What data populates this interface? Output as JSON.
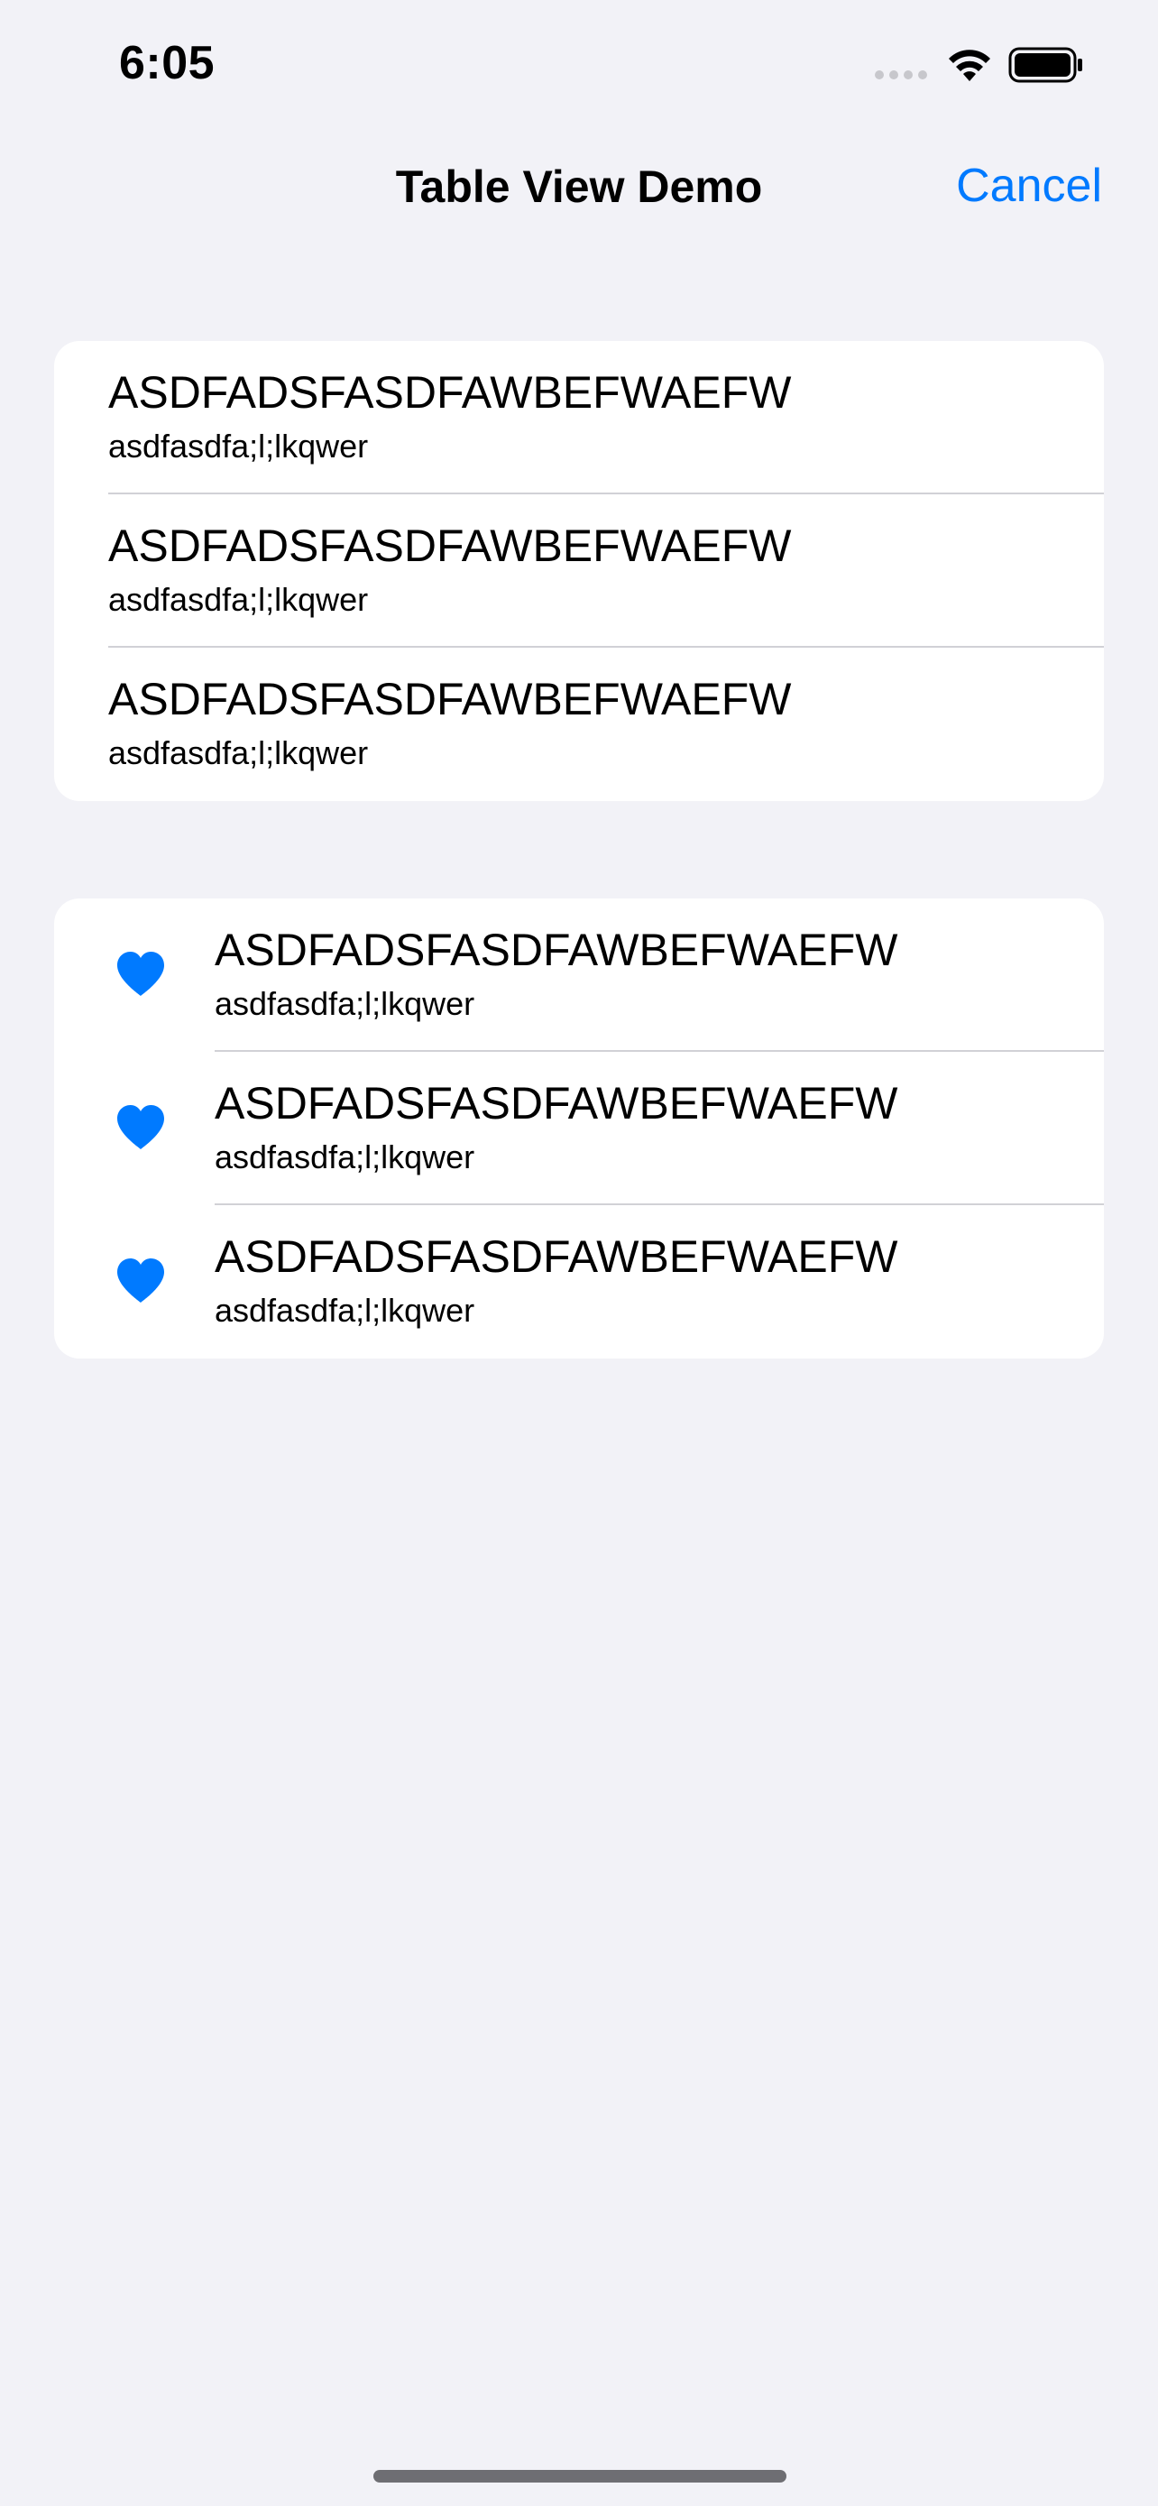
{
  "status_bar": {
    "time": "6:05"
  },
  "nav": {
    "title": "Table View Demo",
    "cancel_label": "Cancel"
  },
  "colors": {
    "accent": "#007aff",
    "background": "#f2f2f7",
    "cell": "#ffffff",
    "separator": "#d1d1d6"
  },
  "section_1": {
    "rows": [
      {
        "title": "ASDFADSFASDFAWBEFWAEFW",
        "subtitle": "asdfasdfa;l;lkqwer"
      },
      {
        "title": "ASDFADSFASDFAWBEFWAEFW",
        "subtitle": "asdfasdfa;l;lkqwer"
      },
      {
        "title": "ASDFADSFASDFAWBEFWAEFW",
        "subtitle": "asdfasdfa;l;lkqwer"
      }
    ]
  },
  "section_2": {
    "icon": "heart-icon",
    "rows": [
      {
        "title": "ASDFADSFASDFAWBEFWAEFW",
        "subtitle": "asdfasdfa;l;lkqwer"
      },
      {
        "title": "ASDFADSFASDFAWBEFWAEFW",
        "subtitle": "asdfasdfa;l;lkqwer"
      },
      {
        "title": "ASDFADSFASDFAWBEFWAEFW",
        "subtitle": "asdfasdfa;l;lkqwer"
      }
    ]
  }
}
